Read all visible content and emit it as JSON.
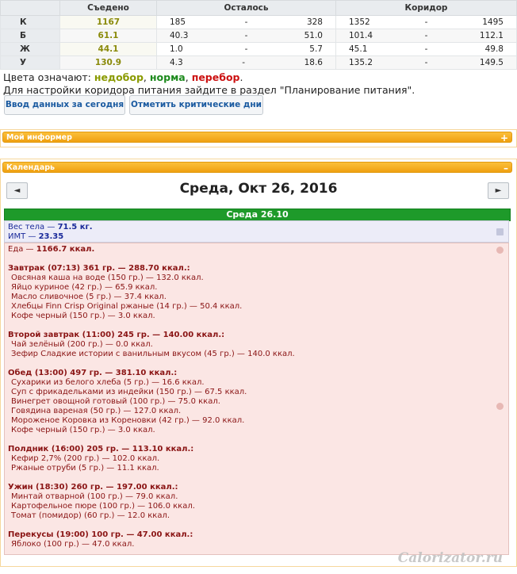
{
  "summary": {
    "headers": [
      "",
      "Съедено",
      "Осталось",
      "Коридор"
    ],
    "rows": [
      {
        "label": "К",
        "eaten": "1167",
        "left_a": "185",
        "dash1": "-",
        "left_b": "328",
        "cor_a": "1352",
        "dash2": "-",
        "cor_b": "1495"
      },
      {
        "label": "Б",
        "eaten": "61.1",
        "left_a": "40.3",
        "dash1": "-",
        "left_b": "51.0",
        "cor_a": "101.4",
        "dash2": "-",
        "cor_b": "112.1"
      },
      {
        "label": "Ж",
        "eaten": "44.1",
        "left_a": "1.0",
        "dash1": "-",
        "left_b": "5.7",
        "cor_a": "45.1",
        "dash2": "-",
        "cor_b": "49.8"
      },
      {
        "label": "У",
        "eaten": "130.9",
        "left_a": "4.3",
        "dash1": "-",
        "left_b": "18.6",
        "cor_a": "135.2",
        "dash2": "-",
        "cor_b": "149.5"
      }
    ]
  },
  "legend": {
    "prefix": "Цвета означают:",
    "under": "недобор",
    "sep1": ",",
    "norm": "норма",
    "sep2": ",",
    "over": "перебор",
    "end": ".",
    "line2": "Для настройки коридора питания зайдите в раздел \"Планирование питания\"."
  },
  "buttons": {
    "enter_today": "Ввод данных за сегодня",
    "mark_critical": "Отметить критические дни"
  },
  "panels": {
    "informer": "Мой информер",
    "informer_icon": "+",
    "calendar": "Календарь",
    "calendar_icon": "–"
  },
  "calendar": {
    "prev": "◄",
    "next": "►",
    "title": "Среда, Окт 26, 2016",
    "day_header": "Среда 26.10"
  },
  "bio": {
    "weight_label": "Вес тела —",
    "weight_value": "71.5 кг.",
    "bmi_label": "ИМТ —",
    "bmi_value": "23.35"
  },
  "food": {
    "total_label": "Еда —",
    "total_value": "1166.7 ккал.",
    "meals": [
      {
        "title": "Завтрак (07:13) 361 гр. — 288.70 ккал.:",
        "items": [
          "Овсяная каша на воде (150 гр.) — 132.0 ккал.",
          "Яйцо куриное (42 гр.) — 65.9 ккал.",
          "Масло сливочное (5 гр.) — 37.4 ккал.",
          "Хлебцы Finn Crisp Original ржаные (14 гр.) — 50.4 ккал.",
          "Кофе черный (150 гр.) — 3.0 ккал."
        ]
      },
      {
        "title": "Второй завтрак (11:00) 245 гр. — 140.00 ккал.:",
        "items": [
          "Чай зелёный (200 гр.) — 0.0 ккал.",
          "Зефир Сладкие истории с ванильным вкусом (45 гр.) — 140.0 ккал."
        ]
      },
      {
        "title": "Обед (13:00) 497 гр. — 381.10 ккал.:",
        "items": [
          "Сухарики из белого хлеба (5 гр.) — 16.6 ккал.",
          "Суп с фрикадельками из индейки (150 гр.) — 67.5 ккал.",
          "Винегрет овощной готовый (100 гр.) — 75.0 ккал.",
          "Говядина вареная (50 гр.) — 127.0 ккал.",
          "Мороженое Коровка из Кореновки (42 гр.) — 92.0 ккал.",
          "Кофе черный (150 гр.) — 3.0 ккал."
        ]
      },
      {
        "title": "Полдник (16:00) 205 гр. — 113.10 ккал.:",
        "items": [
          "Кефир 2,7% (200 гр.) — 102.0 ккал.",
          "Ржаные отруби (5 гр.) — 11.1 ккал."
        ]
      },
      {
        "title": "Ужин (18:30) 260 гр. — 197.00 ккал.:",
        "items": [
          "Минтай отварной (100 гр.) — 79.0 ккал.",
          "Картофельное пюре (100 гр.) — 106.0 ккал.",
          "Томат (помидор) (60 гр.) — 12.0 ккал."
        ]
      },
      {
        "title": "Перекусы (19:00) 100 гр. — 47.00 ккал.:",
        "items": [
          "Яблоко (100 гр.) — 47.0 ккал."
        ]
      }
    ]
  },
  "watermark": "Calorizator.ru"
}
